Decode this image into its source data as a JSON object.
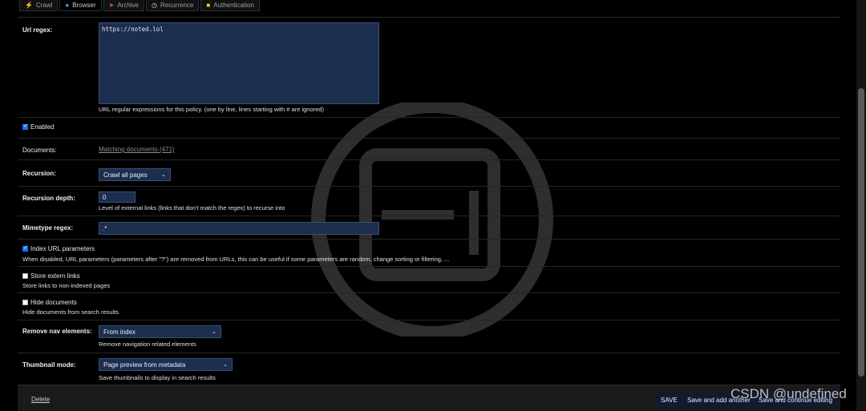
{
  "tabs": [
    {
      "label": "Crawl",
      "icon": "bolt-icon"
    },
    {
      "label": "Browser",
      "icon": "globe-icon"
    },
    {
      "label": "Archive",
      "icon": "rocket-icon"
    },
    {
      "label": "Recurrence",
      "icon": "clock-icon"
    },
    {
      "label": "Authentication",
      "icon": "lock-icon"
    }
  ],
  "url_regex": {
    "label": "Url regex:",
    "value": "https://noted.lol",
    "help": "URL regular expressions for this policy. (one by line, lines starting with # are ignored)"
  },
  "enabled": {
    "label": "Enabled",
    "checked": true
  },
  "documents": {
    "label": "Documents:",
    "link": "Matching documents (471)"
  },
  "recursion": {
    "label": "Recursion:",
    "value": "Crawl all pages"
  },
  "recursion_depth": {
    "label": "Recursion depth:",
    "value": "0",
    "help": "Level of external links (links that don't match the regex) to recurse into"
  },
  "mimetype_regex": {
    "label": "Mimetype regex:",
    "value": ".*"
  },
  "index_url_params": {
    "label": "Index URL parameters",
    "checked": true,
    "help": "When disabled, URL parameters (parameters after \"?\") are removed from URLs, this can be useful if some parameters are random, change sorting or filtering, ..."
  },
  "store_extern_links": {
    "label": "Store extern links",
    "checked": false,
    "help": "Store links to non-indexed pages"
  },
  "hide_documents": {
    "label": "Hide documents",
    "checked": false,
    "help": "Hide documents from search results"
  },
  "remove_nav": {
    "label": "Remove nav elements:",
    "value": "From index",
    "help": "Remove navigation related elements"
  },
  "thumbnail_mode": {
    "label": "Thumbnail mode:",
    "value": "Page preview from metadata",
    "help": "Save thumbnails to display in search results"
  },
  "footer": {
    "delete": "Delete",
    "save": "SAVE",
    "save_add": "Save and add another",
    "save_continue": "Save and continue editing"
  },
  "watermark_text": "CSDN @undefined",
  "colors": {
    "accent": "#1c2e4e",
    "checkbox": "#1a73e8",
    "background": "#000000"
  }
}
